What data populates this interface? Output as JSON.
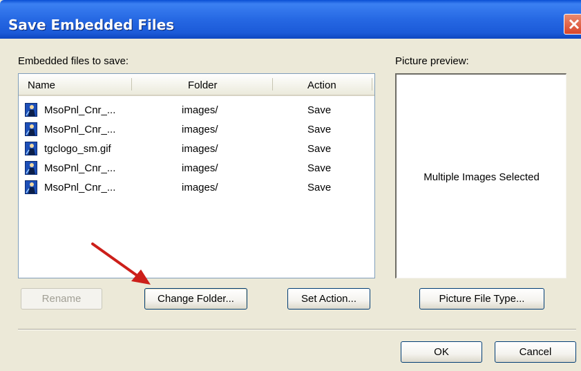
{
  "window": {
    "title": "Save Embedded Files"
  },
  "labels": {
    "embedded_files": "Embedded files to save:",
    "picture_preview": "Picture preview:"
  },
  "list": {
    "columns": [
      "Name",
      "Folder",
      "Action"
    ],
    "rows": [
      {
        "name": "MsoPnl_Cnr_...",
        "folder": "images/",
        "action": "Save",
        "icon": "image-file-icon"
      },
      {
        "name": "MsoPnl_Cnr_...",
        "folder": "images/",
        "action": "Save",
        "icon": "image-file-icon"
      },
      {
        "name": "tgclogo_sm.gif",
        "folder": "images/",
        "action": "Save",
        "icon": "image-file-icon"
      },
      {
        "name": "MsoPnl_Cnr_...",
        "folder": "images/",
        "action": "Save",
        "icon": "image-file-icon"
      },
      {
        "name": "MsoPnl_Cnr_...",
        "folder": "images/",
        "action": "Save",
        "icon": "image-file-icon"
      }
    ]
  },
  "preview": {
    "text": "Multiple Images Selected"
  },
  "buttons": {
    "rename": "Rename",
    "change_folder": "Change Folder...",
    "set_action": "Set Action...",
    "picture_file_type": "Picture File Type...",
    "ok": "OK",
    "cancel": "Cancel"
  },
  "colors": {
    "titlebar": "#2668e3",
    "dialog_bg": "#ece9d8",
    "close_button": "#d9452a",
    "annotation_arrow": "#cc1f1a"
  }
}
